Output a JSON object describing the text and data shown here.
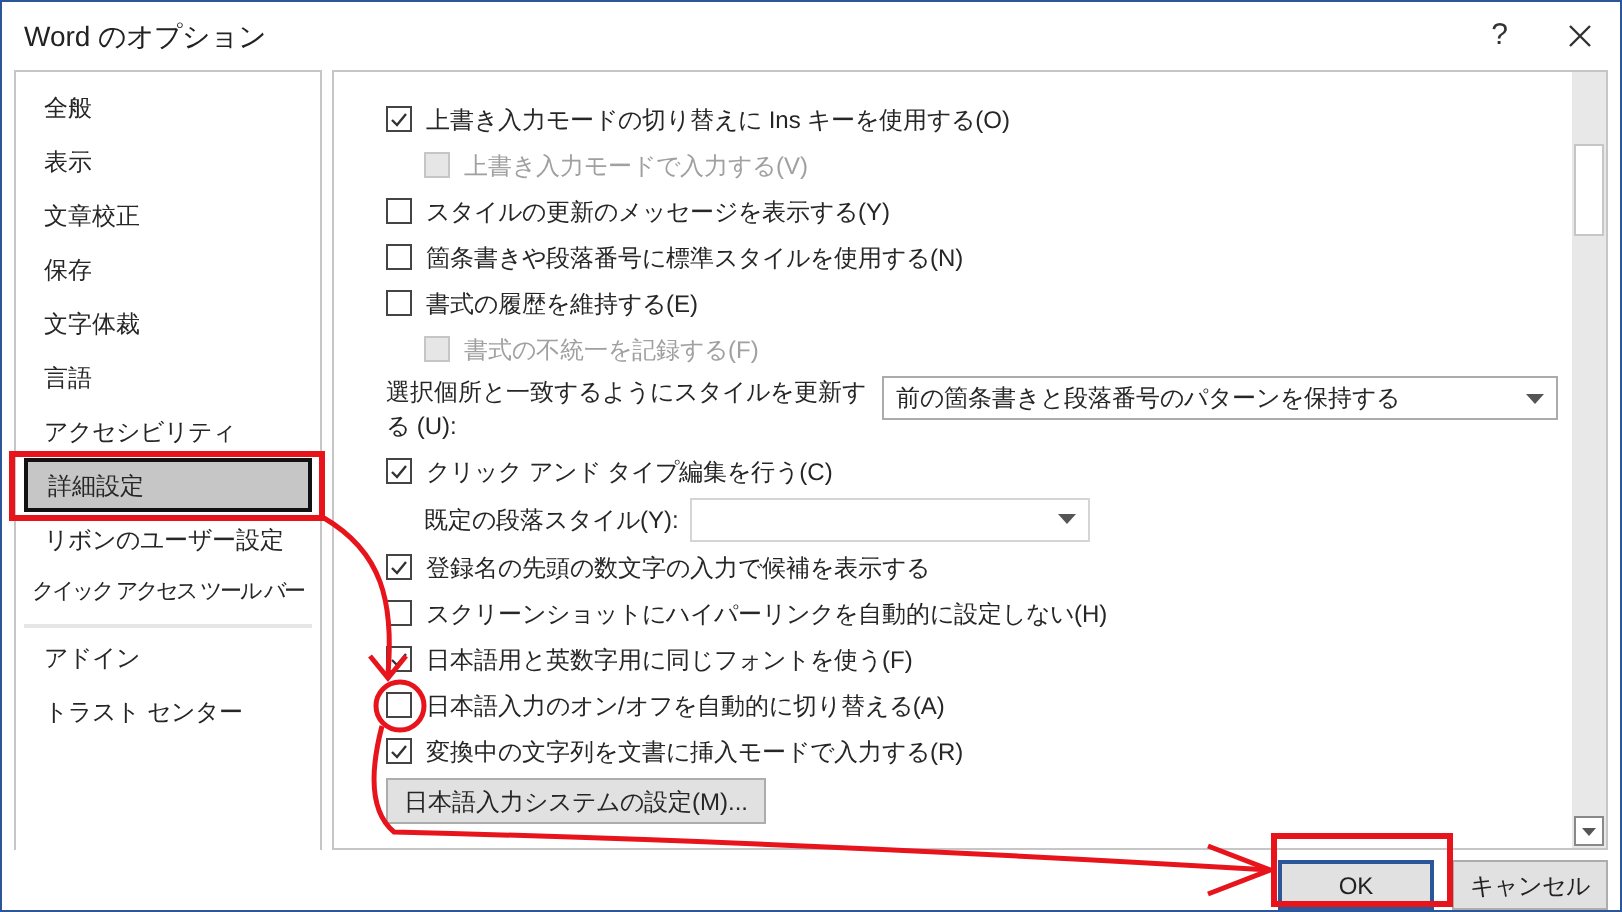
{
  "window": {
    "title": "Word のオプション",
    "help": "?"
  },
  "sidebar": {
    "groups": [
      [
        {
          "label": "全般",
          "selected": false
        },
        {
          "label": "表示",
          "selected": false
        },
        {
          "label": "文章校正",
          "selected": false
        },
        {
          "label": "保存",
          "selected": false
        },
        {
          "label": "文字体裁",
          "selected": false
        },
        {
          "label": "言語",
          "selected": false
        },
        {
          "label": "アクセシビリティ",
          "selected": false
        },
        {
          "label": "詳細設定",
          "selected": true
        },
        {
          "label": "リボンのユーザー設定",
          "selected": false
        },
        {
          "label": "クイック アクセス ツール バー",
          "selected": false
        }
      ],
      [
        {
          "label": "アドイン",
          "selected": false
        },
        {
          "label": "トラスト センター",
          "selected": false
        }
      ]
    ]
  },
  "options": [
    {
      "kind": "checkbox",
      "label": "上書き入力モードの切り替えに Ins キーを使用する(O)",
      "checked": true,
      "disabled": false,
      "indented": false
    },
    {
      "kind": "checkbox",
      "label": "上書き入力モードで入力する(V)",
      "checked": false,
      "disabled": true,
      "indented": true
    },
    {
      "kind": "checkbox",
      "label": "スタイルの更新のメッセージを表示する(Y)",
      "checked": false,
      "disabled": false,
      "indented": false
    },
    {
      "kind": "checkbox",
      "label": "箇条書きや段落番号に標準スタイルを使用する(N)",
      "checked": false,
      "disabled": false,
      "indented": false
    },
    {
      "kind": "checkbox",
      "label": "書式の履歴を維持する(E)",
      "checked": false,
      "disabled": false,
      "indented": false
    },
    {
      "kind": "checkbox",
      "label": "書式の不統一を記録する(F)",
      "checked": false,
      "disabled": true,
      "indented": true
    },
    {
      "kind": "select",
      "label": "選択個所と一致するようにスタイルを更新する (U):",
      "value": "前の箇条書きと段落番号のパターンを保持する",
      "indented": false
    },
    {
      "kind": "checkbox",
      "label": "クリック アンド タイプ編集を行う(C)",
      "checked": true,
      "disabled": false,
      "indented": false
    },
    {
      "kind": "select",
      "label": "既定の段落スタイル(Y):",
      "indented": true
    },
    {
      "kind": "checkbox",
      "label": "登録名の先頭の数文字の入力で候補を表示する",
      "checked": true,
      "disabled": false,
      "indented": false
    },
    {
      "kind": "checkbox",
      "label": "スクリーンショットにハイパーリンクを自動的に設定しない(H)",
      "checked": false,
      "disabled": false,
      "indented": false
    },
    {
      "kind": "checkbox",
      "label": "日本語用と英数字用に同じフォントを使う(F)",
      "checked": true,
      "disabled": false,
      "indented": false
    },
    {
      "kind": "checkbox",
      "label": "日本語入力のオン/オフを自動的に切り替える(A)",
      "checked": false,
      "disabled": false,
      "indented": false
    },
    {
      "kind": "checkbox",
      "label": "変換中の文字列を文書に挿入モードで入力する(R)",
      "checked": true,
      "disabled": false,
      "indented": false
    },
    {
      "kind": "button",
      "label": "日本語入力システムの設定(M)..."
    }
  ],
  "buttons": [
    {
      "label": "OK",
      "selected": true
    },
    {
      "label": "キャンセル",
      "selected": false
    }
  ]
}
